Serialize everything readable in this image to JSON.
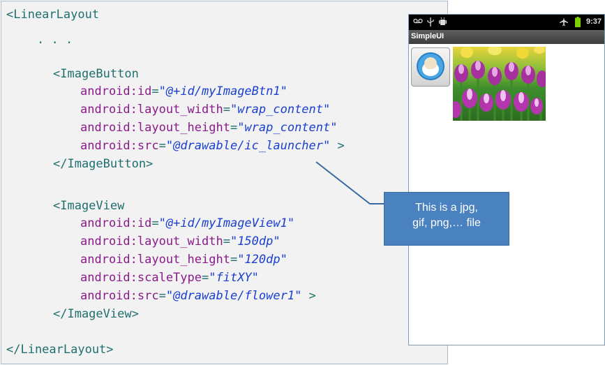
{
  "code": {
    "linear_open": "<LinearLayout",
    "ellipsis": ". . .",
    "imagebutton_open": "<ImageButton",
    "ib_id_attr": "android:id",
    "ib_id_val": "\"@+id/myImageBtn1\"",
    "ib_w_attr": "android:layout_width",
    "ib_w_val": "\"wrap_content\"",
    "ib_h_attr": "android:layout_height",
    "ib_h_val": "\"wrap_content\"",
    "ib_src_attr": "android:src",
    "ib_src_val": "\"@drawable/ic_launcher\"",
    "ib_close_bracket": " >",
    "imagebutton_close": "</ImageButton>",
    "imageview_open": "<ImageView",
    "iv_id_attr": "android:id",
    "iv_id_val": "\"@+id/myImageView1\"",
    "iv_w_attr": "android:layout_width",
    "iv_w_val": "\"150dp\"",
    "iv_h_attr": "android:layout_height",
    "iv_h_val": "\"120dp\"",
    "iv_scale_attr": "android:scaleType",
    "iv_scale_val": "\"fitXY\"",
    "iv_src_attr": "android:src",
    "iv_src_val": "\"@drawable/flower1\"",
    "iv_close_bracket": " >",
    "imageview_close": "</ImageView>",
    "linear_close": "</LinearLayout>"
  },
  "phone": {
    "time": "9:37",
    "app_title": "SimpleUI",
    "status_icons": [
      "voicemail-icon",
      "usb-icon",
      "android-debug-icon",
      "airplane-icon",
      "battery-icon"
    ]
  },
  "callout": {
    "line1": "This is a jpg,",
    "line2": "gif, png,… file"
  },
  "colors": {
    "tag": "#1f6f6f",
    "attr": "#8b1a8b",
    "value": "#1a3fd0",
    "callout_bg": "#4a82c0",
    "status_bar": "#000000"
  }
}
